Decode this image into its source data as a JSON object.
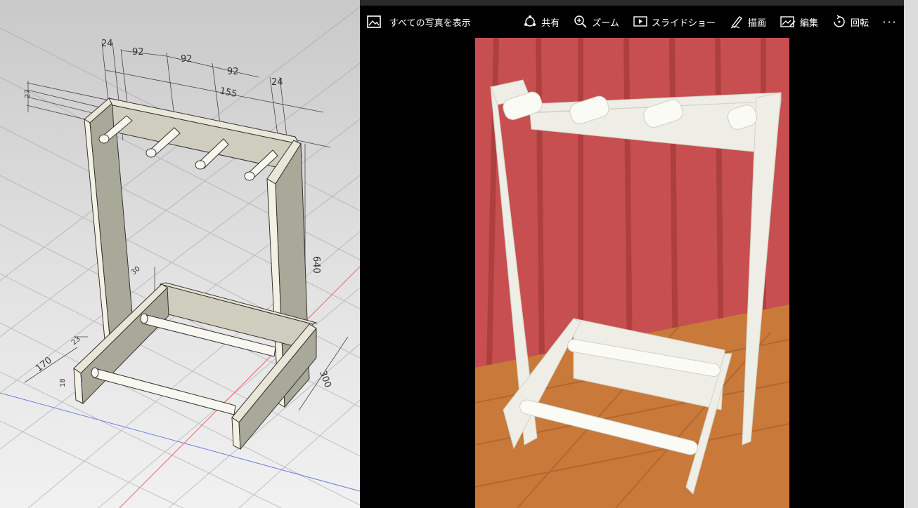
{
  "cad": {
    "dimensions": {
      "d_24_left": "24",
      "d_92_a": "92",
      "d_92_b": "92",
      "d_92_c": "92",
      "d_24_right": "24",
      "d_155": "155",
      "d_640": "640",
      "d_300": "300",
      "d_170": "170",
      "d_30": "30",
      "d_23": "23",
      "d_27": "27",
      "d_18": "18"
    }
  },
  "photos": {
    "toolbar": {
      "back_label": "すべての写真を表示",
      "share_label": "共有",
      "zoom_label": "ズーム",
      "slideshow_label": "スライドショー",
      "draw_label": "描画",
      "edit_label": "編集",
      "rotate_label": "回転",
      "more_label": "···"
    },
    "icons": [
      "photo-icon",
      "share-icon",
      "zoom-icon",
      "slideshow-icon",
      "draw-icon",
      "edit-icon",
      "rotate-icon",
      "more-icon"
    ]
  }
}
